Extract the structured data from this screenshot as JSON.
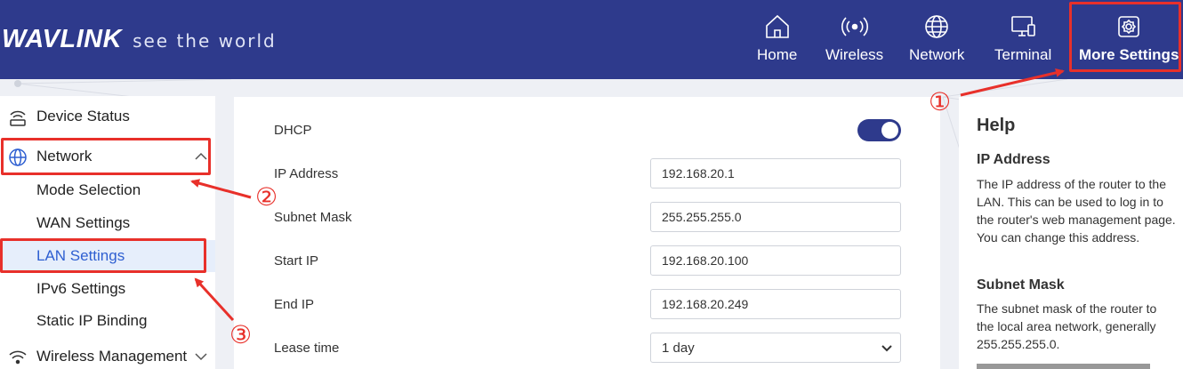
{
  "header": {
    "brand": "WAVLINK",
    "tagline": "see the world",
    "nav": [
      {
        "label": "Home",
        "icon": "home-icon"
      },
      {
        "label": "Wireless",
        "icon": "wireless-icon"
      },
      {
        "label": "Network",
        "icon": "globe-icon"
      },
      {
        "label": "Terminal",
        "icon": "terminal-icon"
      },
      {
        "label": "More Settings",
        "icon": "settings-icon",
        "active": true
      }
    ]
  },
  "sidebar": {
    "items": [
      {
        "label": "Device Status",
        "icon": "router-icon"
      },
      {
        "label": "Network",
        "icon": "globe-icon",
        "expanded": true
      },
      {
        "label": "Mode Selection"
      },
      {
        "label": "WAN Settings"
      },
      {
        "label": "LAN Settings",
        "selected": true
      },
      {
        "label": "IPv6 Settings"
      },
      {
        "label": "Static IP Binding"
      },
      {
        "label": "Wireless Management",
        "icon": "wireless-icon"
      }
    ]
  },
  "form": {
    "dhcp_label": "DHCP",
    "dhcp_enabled": true,
    "ip_label": "IP Address",
    "ip_value": "192.168.20.1",
    "mask_label": "Subnet Mask",
    "mask_value": "255.255.255.0",
    "start_label": "Start IP",
    "start_value": "192.168.20.100",
    "end_label": "End IP",
    "end_value": "192.168.20.249",
    "lease_label": "Lease time",
    "lease_value": "1 day"
  },
  "help": {
    "title": "Help",
    "sections": [
      {
        "heading": "IP Address",
        "text": "The IP address of the router to the LAN. This can be used to log in to the router's web management page. You can change this address."
      },
      {
        "heading": "Subnet Mask",
        "text": "The subnet mask of the router to the local area network, generally 255.255.255.0."
      }
    ]
  },
  "annotations": {
    "step1": "①",
    "step2": "②",
    "step3": "③"
  },
  "colors": {
    "header_bg": "#2e3a8c",
    "accent": "#2e5fd1",
    "annotation": "#e8302a",
    "toggle_on": "#2e3a8c"
  }
}
